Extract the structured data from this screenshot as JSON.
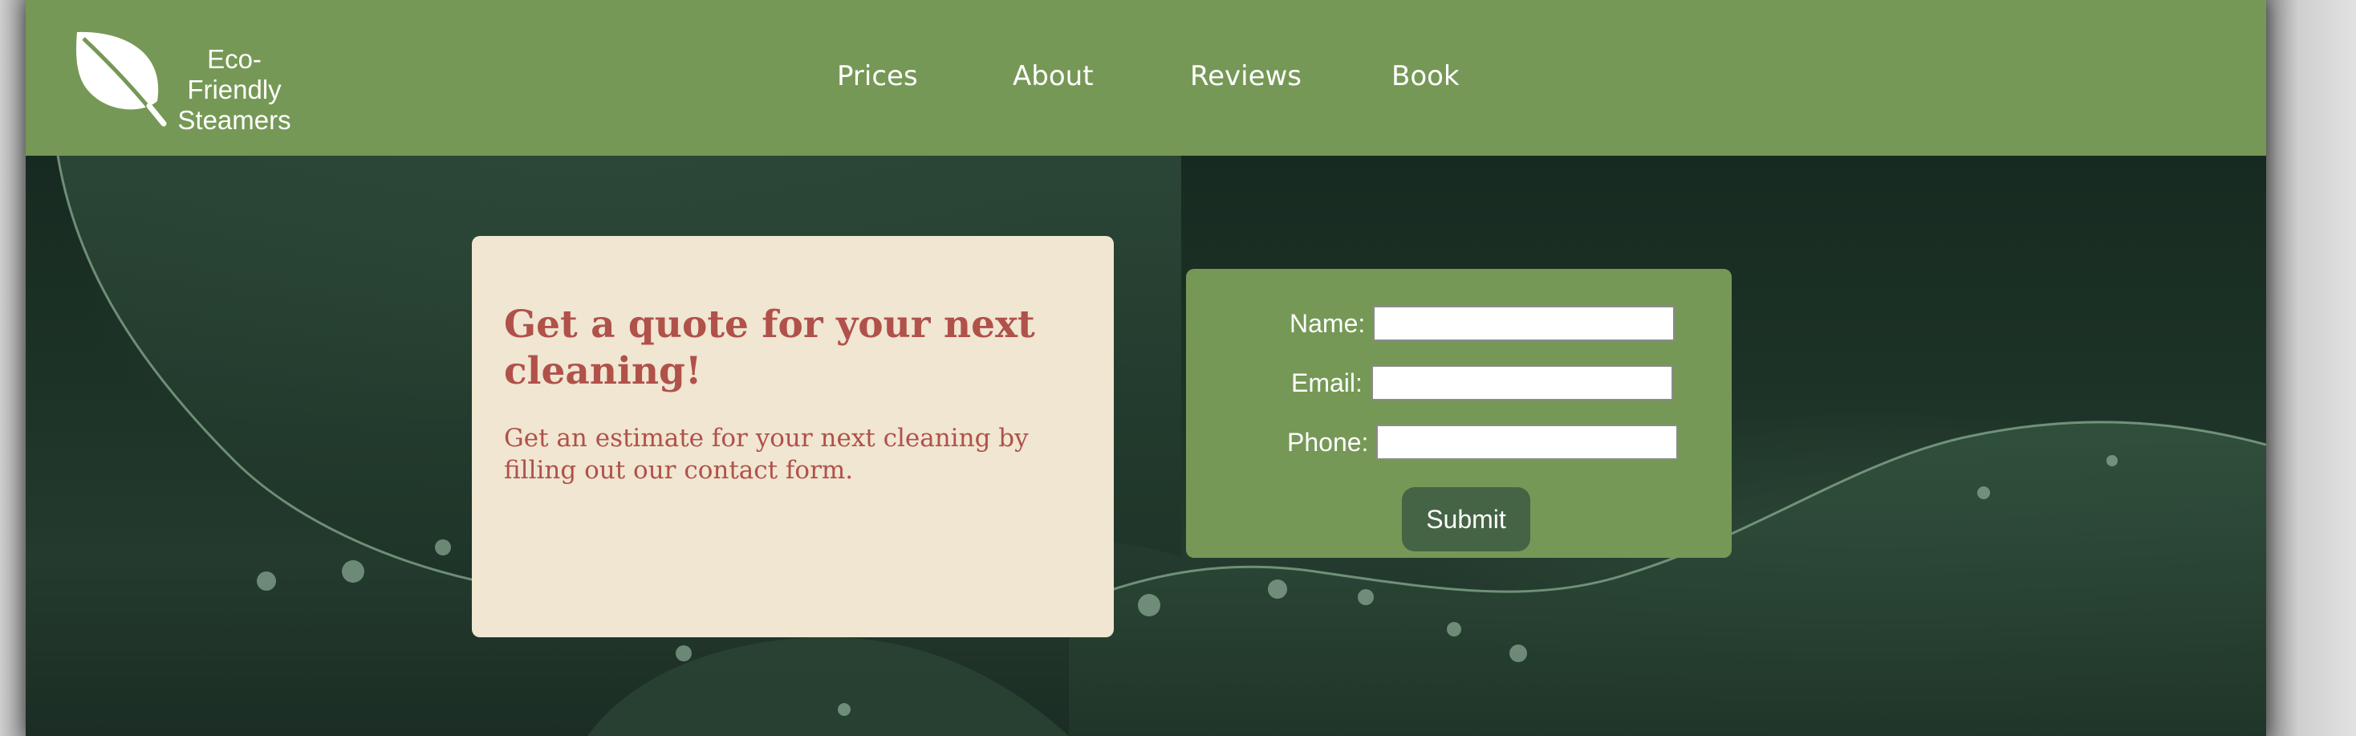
{
  "brand": {
    "line1": "Eco-Friendly",
    "line2": "Steamers",
    "logo_icon": "leaf-icon"
  },
  "nav": {
    "items": [
      {
        "label": "Prices"
      },
      {
        "label": "About"
      },
      {
        "label": "Reviews"
      },
      {
        "label": "Book"
      }
    ]
  },
  "quote": {
    "title": "Get a quote for your next cleaning!",
    "text": "Get an estimate for your next cleaning by filling out our contact form."
  },
  "form": {
    "name_label": "Name:",
    "email_label": "Email:",
    "phone_label": "Phone:",
    "name_value": "",
    "email_value": "",
    "phone_value": "",
    "submit_label": "Submit"
  },
  "colors": {
    "header_bg": "#769856",
    "card_bg": "#f0e6d2",
    "accent_text": "#b0514a",
    "button_bg": "#456345"
  }
}
